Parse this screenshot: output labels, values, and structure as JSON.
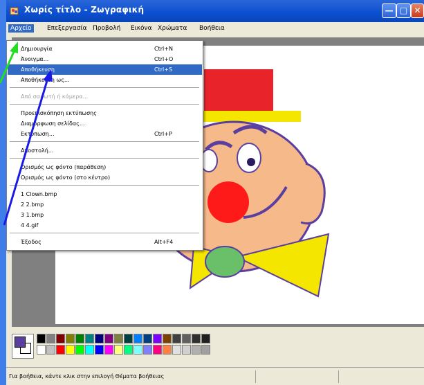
{
  "window": {
    "title": "Χωρίς τίτλο - Ζωγραφική"
  },
  "menubar": {
    "items": [
      "Αρχείο",
      "Επεξεργασία",
      "Προβολή",
      "Εικόνα",
      "Χρώματα",
      "Βοήθεια"
    ]
  },
  "file_menu": {
    "items": [
      {
        "label": "Δημιουργία",
        "shortcut": "Ctrl+N"
      },
      {
        "label": "Άνοιγμα...",
        "shortcut": "Ctrl+O"
      },
      {
        "label": "Αποθήκευση",
        "shortcut": "Ctrl+S",
        "selected": true
      },
      {
        "label": "Αποθήκευση ως...",
        "shortcut": ""
      },
      {
        "label": "Από σαρωτή ή κάμερα...",
        "shortcut": "",
        "disabled": true
      },
      {
        "label": "Προεπισκόπηση εκτύπωσης",
        "shortcut": ""
      },
      {
        "label": "Διαμόρφωση σελίδας...",
        "shortcut": ""
      },
      {
        "label": "Εκτύπωση...",
        "shortcut": "Ctrl+P"
      },
      {
        "label": "Αποστολή...",
        "shortcut": ""
      },
      {
        "label": "Ορισμός ως φόντο (παράθεση)",
        "shortcut": ""
      },
      {
        "label": "Ορισμός ως φόντο (στο κέντρο)",
        "shortcut": ""
      },
      {
        "label": "1 Clown.bmp",
        "shortcut": ""
      },
      {
        "label": "2 2.bmp",
        "shortcut": ""
      },
      {
        "label": "3 1.bmp",
        "shortcut": ""
      },
      {
        "label": "4 4.gif",
        "shortcut": ""
      },
      {
        "label": "Έξοδος",
        "shortcut": "Alt+F4"
      }
    ]
  },
  "statusbar": {
    "text": "Για βοήθεια, κάντε κλικ στην επιλογή Θέματα βοήθειας"
  },
  "palette": {
    "foreground": "#5a3fa0",
    "background": "#ffffff",
    "top_row": [
      "#000000",
      "#808080",
      "#800000",
      "#808000",
      "#008000",
      "#008080",
      "#000080",
      "#800080",
      "#808040",
      "#004040",
      "#0080ff",
      "#004080",
      "#8000ff",
      "#804000",
      "#404040",
      "#606060",
      "#303030",
      "#202020"
    ],
    "bottom_row": [
      "#ffffff",
      "#c0c0c0",
      "#ff0000",
      "#ffff00",
      "#00ff00",
      "#00ffff",
      "#0000ff",
      "#ff00ff",
      "#ffff80",
      "#00ff80",
      "#80ffff",
      "#8080ff",
      "#ff0080",
      "#ff8040",
      "#e0e0e0",
      "#d0d0d0",
      "#b0b0b0",
      "#a0a0a0"
    ]
  },
  "colors": {
    "accent": "#316ac5",
    "hat": "#e8232a",
    "hat_brim": "#f5e600",
    "face": "#f6b98a",
    "outline": "#5a3fa0",
    "nose": "#ff1a1a",
    "bowtie": "#f5e600",
    "bowtie_knot": "#6abf69",
    "arrow_green": "#22dd22",
    "arrow_blue": "#1a1ae6"
  }
}
